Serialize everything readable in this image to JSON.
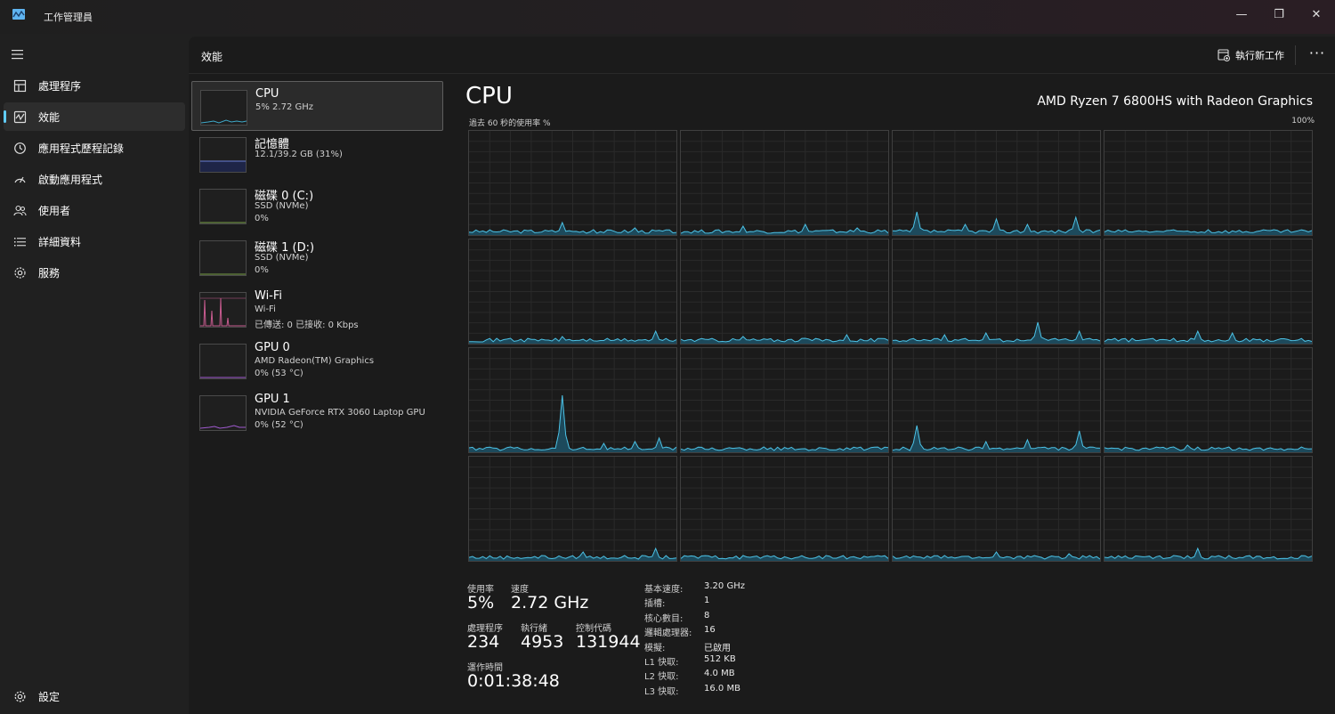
{
  "window": {
    "title": "工作管理員",
    "minimize_glyph": "—",
    "maximize_glyph": "❐",
    "close_glyph": "✕"
  },
  "sidebar": {
    "items": [
      {
        "label": "處理程序",
        "icon": "processes-icon",
        "active": false
      },
      {
        "label": "效能",
        "icon": "performance-icon",
        "active": true
      },
      {
        "label": "應用程式歷程記錄",
        "icon": "history-icon",
        "active": false
      },
      {
        "label": "啟動應用程式",
        "icon": "startup-icon",
        "active": false
      },
      {
        "label": "使用者",
        "icon": "users-icon",
        "active": false
      },
      {
        "label": "詳細資料",
        "icon": "details-icon",
        "active": false
      },
      {
        "label": "服務",
        "icon": "services-icon",
        "active": false
      }
    ],
    "settings_label": "設定"
  },
  "header": {
    "title": "效能",
    "run_task_label": "執行新工作",
    "more_glyph": "···"
  },
  "devices": [
    {
      "name": "CPU",
      "line1": "5%  2.72 GHz",
      "line2": "",
      "color": "#3fa9c9",
      "active": true
    },
    {
      "name": "記憶體",
      "line1": "12.1/39.2 GB (31%)",
      "line2": "",
      "color": "#6a7fd6",
      "active": false
    },
    {
      "name": "磁碟 0 (C:)",
      "line1": "SSD (NVMe)",
      "line2": "0%",
      "color": "#7ba34a",
      "active": false
    },
    {
      "name": "磁碟 1 (D:)",
      "line1": "SSD (NVMe)",
      "line2": "0%",
      "color": "#7ba34a",
      "active": false
    },
    {
      "name": "Wi-Fi",
      "line1": "Wi-Fi",
      "line2": "已傳送: 0 已接收: 0 Kbps",
      "color": "#c75b8f",
      "active": false
    },
    {
      "name": "GPU 0",
      "line1": "AMD Radeon(TM) Graphics",
      "line2": "0%  (53 °C)",
      "color": "#a05ad0",
      "active": false
    },
    {
      "name": "GPU 1",
      "line1": "NVIDIA GeForce RTX 3060 Laptop GPU",
      "line2": "0%  (52 °C)",
      "color": "#a05ad0",
      "active": false
    }
  ],
  "cpu": {
    "title": "CPU",
    "model": "AMD Ryzen 7 6800HS with Radeon Graphics",
    "graph_caption": "過去 60 秒的使用率 %",
    "graph_max": "100%",
    "line_color": "#4cc2e6",
    "fill_color": "#1d4a5c",
    "logical_processors_shown": 16
  },
  "stats": {
    "usage_label": "使用率",
    "usage_value": "5%",
    "speed_label": "速度",
    "speed_value": "2.72 GHz",
    "processes_label": "處理程序",
    "processes_value": "234",
    "threads_label": "執行緒",
    "threads_value": "4953",
    "handles_label": "控制代碼",
    "handles_value": "131944",
    "uptime_label": "運作時間",
    "uptime_value": "0:01:38:48"
  },
  "specs": [
    {
      "label": "基本速度:",
      "value": "3.20 GHz"
    },
    {
      "label": "插槽:",
      "value": "1"
    },
    {
      "label": "核心數目:",
      "value": "8"
    },
    {
      "label": "邏輯處理器:",
      "value": "16"
    },
    {
      "label": "模擬:",
      "value": "已啟用"
    },
    {
      "label": "L1 快取:",
      "value": "512 KB"
    },
    {
      "label": "L2 快取:",
      "value": "4.0 MB"
    },
    {
      "label": "L3 快取:",
      "value": "16.0 MB"
    }
  ]
}
